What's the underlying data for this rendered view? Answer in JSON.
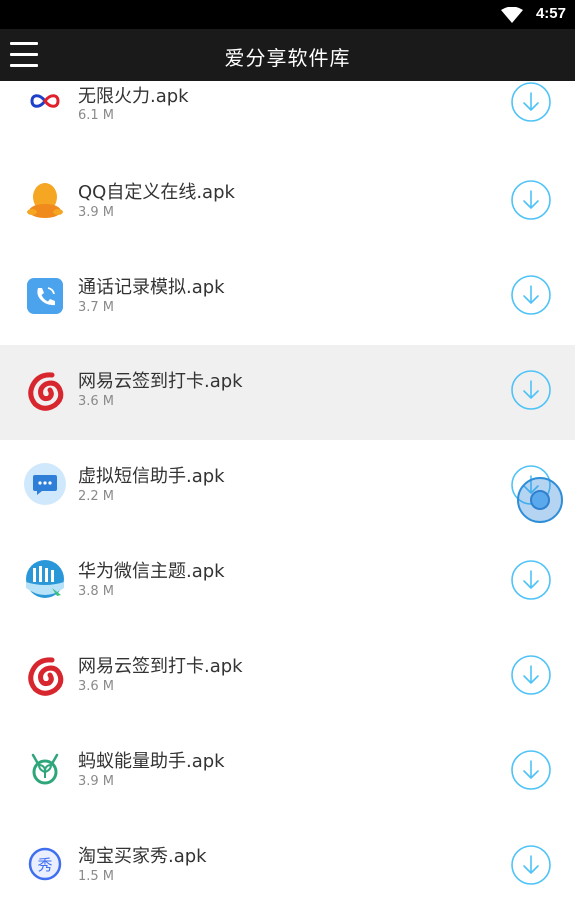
{
  "status_bar": {
    "time": "4:57",
    "wifi_icon": "wifi-icon"
  },
  "app_bar": {
    "menu_icon": "hamburger-menu-icon",
    "title": "爱分享软件库"
  },
  "files": [
    {
      "name": "无限火力.apk",
      "size": "6.1 M",
      "icon": "infinity-icon"
    },
    {
      "name": "QQ自定义在线.apk",
      "size": "3.9 M",
      "icon": "qq-penguin-icon"
    },
    {
      "name": "通话记录模拟.apk",
      "size": "3.7 M",
      "icon": "phone-call-icon"
    },
    {
      "name": "网易云签到打卡.apk",
      "size": "3.6 M",
      "icon": "netease-music-icon",
      "highlighted": true
    },
    {
      "name": "虚拟短信助手.apk",
      "size": "2.2 M",
      "icon": "message-bubble-icon"
    },
    {
      "name": "华为微信主题.apk",
      "size": "3.8 M",
      "icon": "huawei-theme-icon"
    },
    {
      "name": "网易云签到打卡.apk",
      "size": "3.6 M",
      "icon": "netease-music-icon"
    },
    {
      "name": "蚂蚁能量助手.apk",
      "size": "3.9 M",
      "icon": "ant-sprout-icon"
    },
    {
      "name": "淘宝买家秀.apk",
      "size": "1.5 M",
      "icon": "taobao-show-icon",
      "badge_text": "秀"
    }
  ],
  "download_icon": "download-arrow-icon",
  "floating_button_icon": "floating-assist-icon",
  "colors": {
    "accent": "#4fc3f7",
    "app_bar": "#1a1a1a",
    "highlight_row": "#f0f0f0",
    "netease_red": "#d8262e"
  }
}
